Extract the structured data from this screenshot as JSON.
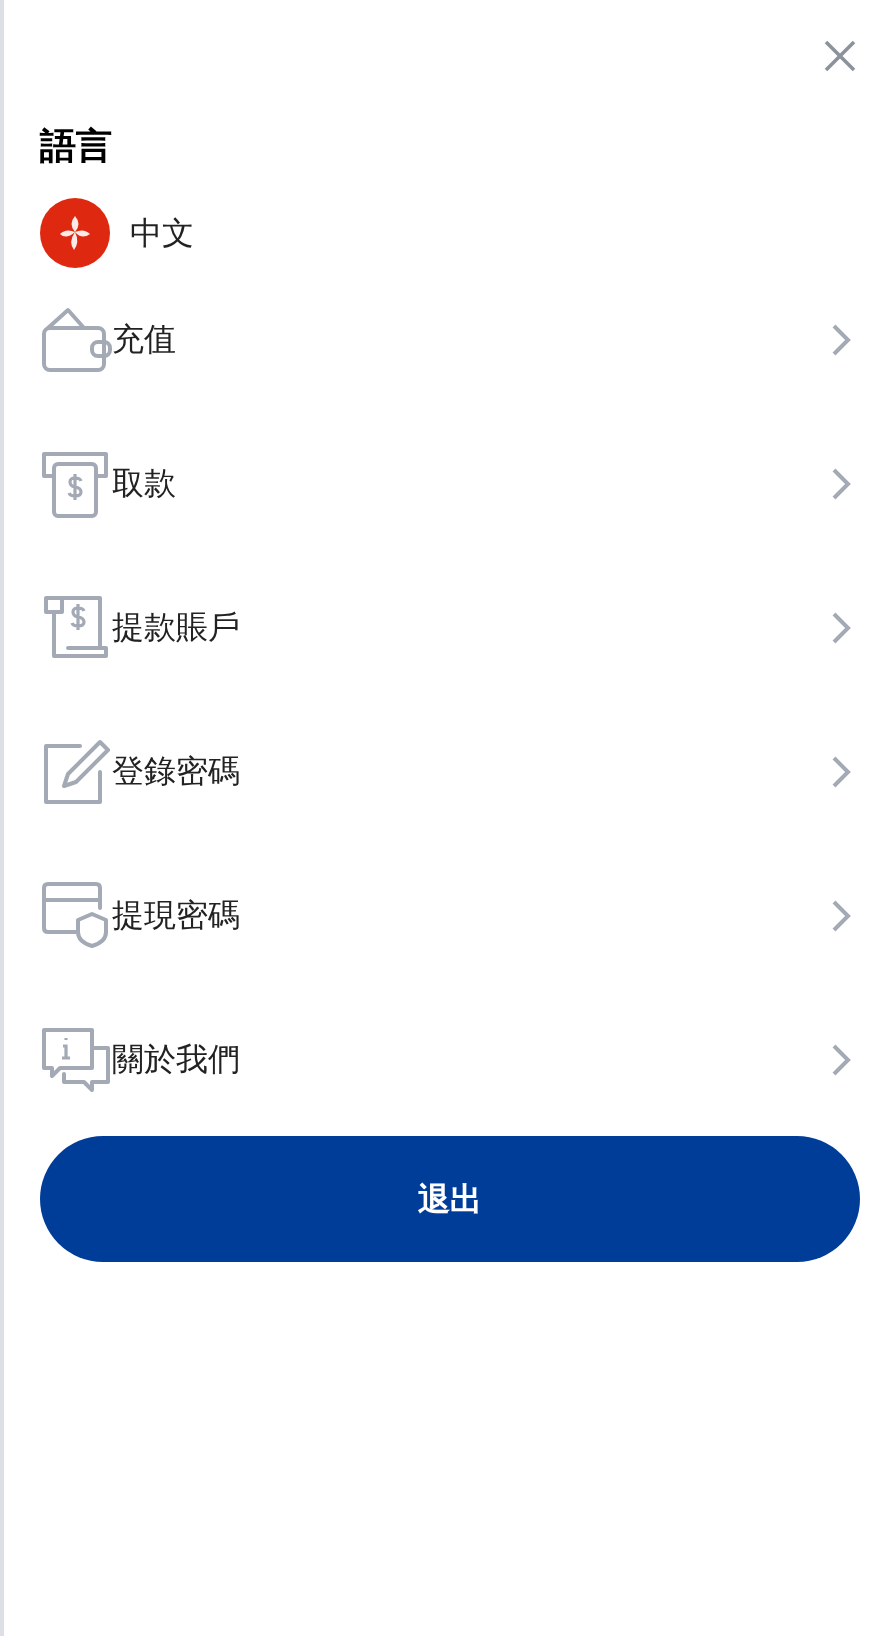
{
  "language": {
    "title": "語言",
    "current": "中文"
  },
  "menu": [
    {
      "kind": "wallet",
      "label": "充值"
    },
    {
      "kind": "atm",
      "label": "取款"
    },
    {
      "kind": "receipt",
      "label": "提款賬戶"
    },
    {
      "kind": "edit",
      "label": "登錄密碼"
    },
    {
      "kind": "card-shield",
      "label": "提現密碼"
    },
    {
      "kind": "info-chat",
      "label": "關於我們"
    }
  ],
  "logout_button": "退出"
}
